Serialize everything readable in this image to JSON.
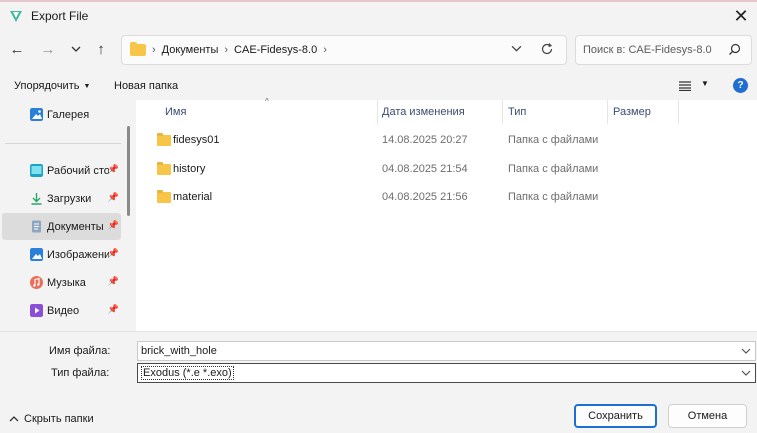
{
  "window": {
    "title": "Export File",
    "close_glyph": "✕"
  },
  "nav": {
    "back_glyph": "←",
    "forward_glyph": "→",
    "recent_glyph": "⌄",
    "up_glyph": "↑",
    "breadcrumb": [
      "Документы",
      "CAE-Fidesys-8.0"
    ],
    "separator": "›",
    "search_placeholder": "Поиск в: CAE-Fidesys-8.0"
  },
  "toolbar": {
    "organize": "Упорядочить",
    "new_folder": "Новая папка",
    "help": "?"
  },
  "sidebar": {
    "items": [
      {
        "label": "Галерея",
        "icon": "gallery-icon",
        "pinned": false,
        "selected": false
      },
      {
        "label": "Рабочий сто",
        "icon": "desktop-icon",
        "pinned": true,
        "selected": false
      },
      {
        "label": "Загрузки",
        "icon": "downloads-icon",
        "pinned": true,
        "selected": false
      },
      {
        "label": "Документы",
        "icon": "documents-icon",
        "pinned": true,
        "selected": true
      },
      {
        "label": "Изображени",
        "icon": "pictures-icon",
        "pinned": true,
        "selected": false
      },
      {
        "label": "Музыка",
        "icon": "music-icon",
        "pinned": true,
        "selected": false
      },
      {
        "label": "Видео",
        "icon": "videos-icon",
        "pinned": true,
        "selected": false
      }
    ],
    "pin_glyph": "📌"
  },
  "columns": {
    "name": "Имя",
    "date": "Дата изменения",
    "type": "Тип",
    "size": "Размер"
  },
  "files": [
    {
      "name": "fidesys01",
      "date": "14.08.2025 20:27",
      "type": "Папка с файлами"
    },
    {
      "name": "history",
      "date": "04.08.2025 21:54",
      "type": "Папка с файлами"
    },
    {
      "name": "material",
      "date": "04.08.2025 21:56",
      "type": "Папка с файлами"
    }
  ],
  "form": {
    "filename_label": "Имя файла:",
    "filename_value": "brick_with_hole",
    "filetype_label": "Тип файла:",
    "filetype_value": "Exodus (*.e *.exo)",
    "hide_folders": "Скрыть папки",
    "save": "Сохранить",
    "cancel": "Отмена"
  },
  "colors": {
    "accent": "#1e6fd1",
    "folder": "#f7c548"
  }
}
